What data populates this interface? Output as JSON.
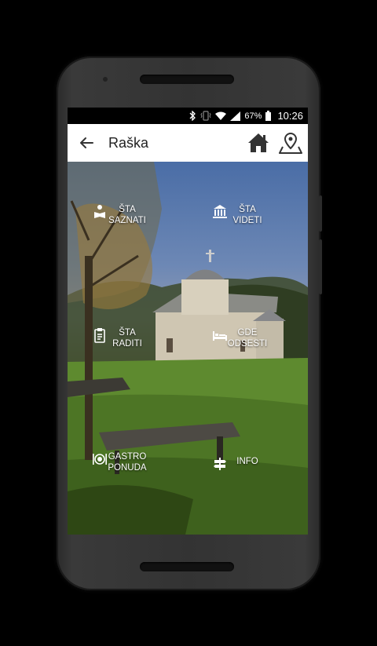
{
  "status": {
    "battery_pct": "67%",
    "time": "10:26"
  },
  "appbar": {
    "title": "Raška",
    "back_icon": "arrow-left-icon",
    "home_icon": "home-icon",
    "map_icon": "map-pin-icon"
  },
  "menu": {
    "sta_saznati": "ŠTA\nSAZNATI",
    "sta_videti": "ŠTA\nVIDETI",
    "sta_raditi": "ŠTA\nRADITI",
    "gde_odsesti": "GDE\nODSESTI",
    "gastro_ponuda": "GASTRO\nPONUDA",
    "info": "INFO"
  }
}
